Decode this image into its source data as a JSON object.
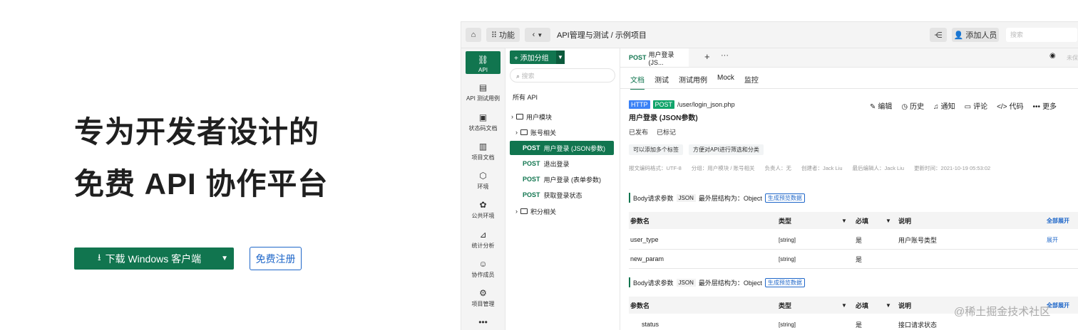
{
  "hero": {
    "title_line1": "专为开发者设计的",
    "title_line2": "免费 API 协作平台",
    "download_label": "下载 Windows 客户端",
    "register_label": "免费注册"
  },
  "topbar": {
    "home_icon": "home-icon",
    "features_label": "功能",
    "breadcrumb": "API管理与测试 / 示例项目",
    "add_member_label": "添加人员",
    "search_placeholder": "搜索"
  },
  "leftnav": {
    "items": [
      {
        "label": "API",
        "icon": "link-icon"
      },
      {
        "label": "API 测试用例",
        "icon": "clipboard-icon"
      },
      {
        "label": "状态码文档",
        "icon": "doc-icon"
      },
      {
        "label": "项目文档",
        "icon": "book-icon"
      },
      {
        "label": "环境",
        "icon": "cube-icon"
      },
      {
        "label": "公共环境",
        "icon": "cloud-icon"
      },
      {
        "label": "统计分析",
        "icon": "chart-icon"
      },
      {
        "label": "协作成员",
        "icon": "people-icon"
      },
      {
        "label": "项目管理",
        "icon": "gear-icon"
      }
    ],
    "more": "•••"
  },
  "tree": {
    "add_group_label": "+ 添加分组",
    "search_placeholder": "搜索",
    "all_api": "所有 API",
    "user_module": "用户模块",
    "account_folder": "账号相关",
    "items": [
      {
        "method": "POST",
        "name": "用户登录 (JSON参数)"
      },
      {
        "method": "POST",
        "name": "退出登录"
      },
      {
        "method": "POST",
        "name": "用户登录 (表单参数)"
      },
      {
        "method": "POST",
        "name": "获取登录状态"
      }
    ],
    "points_folder": "积分相关"
  },
  "main": {
    "tab_method": "POST",
    "tab_name": "用户登录 (JS...",
    "tab_plus": "+",
    "tab_more": "···",
    "eye_text": "未保",
    "subtabs": [
      "文档",
      "测试",
      "测试用例",
      "Mock",
      "监控"
    ],
    "protocol": "HTTP",
    "method": "POST",
    "path": "/user/login_json.php",
    "title": "用户登录 (JSON参数)",
    "actions": [
      "编辑",
      "历史",
      "通知",
      "评论",
      "代码",
      "更多"
    ],
    "status": [
      "已发布",
      "已标记"
    ],
    "tags": [
      "可以添加多个标签",
      "方便对API进行筛选和分类"
    ],
    "meta": [
      "报文编码格式：UTF-8",
      "分组：用户模块 / 账号相关",
      "负责人：无",
      "创建者：Jack Liu",
      "最后编辑人：Jack Liu",
      "更新时间：2021-10-19 05:53:02"
    ],
    "section_title": "Body请求参数",
    "section_type": "JSON",
    "section_struct": "最外层结构为：Object",
    "section_preview": "生成预览数据",
    "col_name": "参数名",
    "col_type": "类型",
    "col_required": "必填",
    "col_desc": "说明",
    "expand_all": "全部展开",
    "expand": "展开",
    "table1": [
      {
        "name": "user_type",
        "type": "[string]",
        "required": "是",
        "desc": "用户账号类型"
      },
      {
        "name": "new_param",
        "type": "[string]",
        "required": "是",
        "desc": ""
      }
    ],
    "table2": [
      {
        "name": "status",
        "type": "[string]",
        "required": "是",
        "desc": "接口请求状态"
      }
    ]
  },
  "watermark": "@稀土掘金技术社区",
  "colors": {
    "brand_green": "#11754f",
    "link_blue": "#1f67c9"
  }
}
